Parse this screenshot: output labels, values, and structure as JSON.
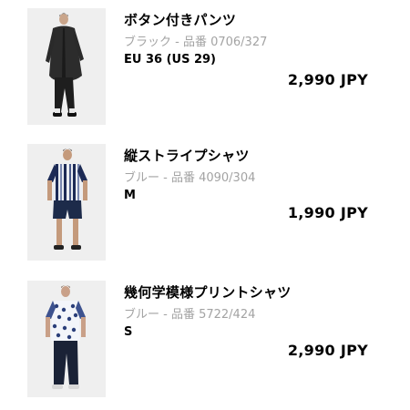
{
  "cart": {
    "items": [
      {
        "title": "ボタン付きパンツ",
        "variant": "ブラック - 品番 0706/327",
        "size": "EU 36 (US 29)",
        "price": "2,990 JPY"
      },
      {
        "title": "縦ストライプシャツ",
        "variant": "ブルー - 品番 4090/304",
        "size": "M",
        "price": "1,990 JPY"
      },
      {
        "title": "幾何学模様プリントシャツ",
        "variant": "ブルー - 品番 5722/424",
        "size": "S",
        "price": "2,990 JPY"
      }
    ]
  },
  "colors": {
    "variant_text": "#a3a3a3",
    "thumb_background": "#f0f0f0"
  }
}
